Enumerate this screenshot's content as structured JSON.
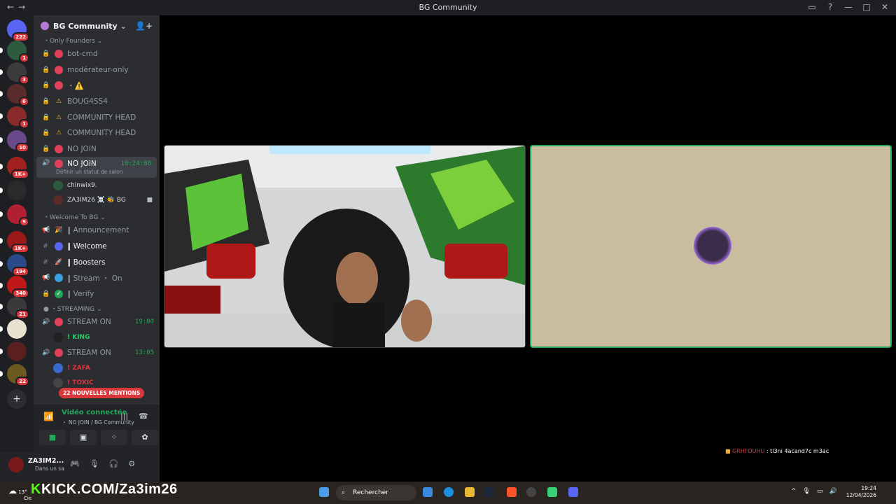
{
  "window": {
    "title": "BG Community",
    "nav_back": "←",
    "nav_fwd": "→",
    "controls": [
      "▭",
      "?",
      "—",
      "□",
      "✕"
    ]
  },
  "servers": {
    "home_badge": "222",
    "items": [
      {
        "badge": "1",
        "color": "#2e5a3e"
      },
      {
        "badge": "3",
        "color": "#3b3b3b"
      },
      {
        "badge": "6",
        "color": "#5a2b2b"
      },
      {
        "badge": "1",
        "color": "#8a2b2b"
      },
      {
        "badge": "10",
        "color": "#6a4a8a"
      },
      {
        "badge": "1K+",
        "color": "#a02020"
      },
      {
        "badge": "",
        "color": "#2a2a2a"
      },
      {
        "badge": "9",
        "color": "#b02030"
      },
      {
        "badge": "1K+",
        "color": "#9a1a1a"
      },
      {
        "badge": "194",
        "color": "#2a4a8a"
      },
      {
        "badge": "340",
        "color": "#c01818"
      },
      {
        "badge": "21",
        "color": "#3a3a3a"
      },
      {
        "badge": "",
        "color": "#e8e0d0"
      },
      {
        "badge": "",
        "color": "#5a2020"
      },
      {
        "badge": "22",
        "color": "#6a5a20"
      }
    ],
    "add_label": "+"
  },
  "guild": {
    "name": "BG Community"
  },
  "categories": {
    "founders": "Only Founders",
    "welcome": "Welcome To BG",
    "streaming": "STREAMING"
  },
  "channels": {
    "c1": "bot-cmd",
    "c2": "modérateur-only",
    "c3": "・⚠️",
    "c4": "BOUG4SS4",
    "c5": "COMMUNITY HEAD",
    "c6": "COMMUNITY HEAD",
    "c7": "NO JOIN",
    "c8": "NO JOIN",
    "c8_time": "10:24:08",
    "c8_sub": "Définir un statut de salon",
    "v1": "chinwix9.",
    "v2": "ZA3IM26 ☠️ 🐝 BG",
    "w1": "‖ Announcement",
    "w2": "‖ Welcome",
    "w3": "‖ Boosters",
    "w4": "‖ Stream ・ On",
    "w5": "‖ Verify",
    "s1": "STREAM ON",
    "s1_time": "19:00",
    "s1_user": "! KING",
    "s2": "STREAM ON",
    "s2_time": "13:05",
    "s2_user": "! ZAFA",
    "s3_user": "! TOXIC"
  },
  "mentions_pill": "22 NOUVELLES MENTIONS",
  "voice": {
    "status": "Vidéo connectée",
    "sub": "・ NO JOIN / BG Community"
  },
  "user": {
    "name": "ZA3IM2...",
    "status": "Dans un sa"
  },
  "stream_chat": {
    "name": "GRHFDUHU",
    "message": " : tl3ni 4acand7c m3ac"
  },
  "taskbar": {
    "kick_brand": "KICK.COM/Za3im26",
    "weather": "13°",
    "weather_sub": "Cie",
    "search_placeholder": "Rechercher",
    "time": "19:24",
    "date": "12/04/2026"
  }
}
